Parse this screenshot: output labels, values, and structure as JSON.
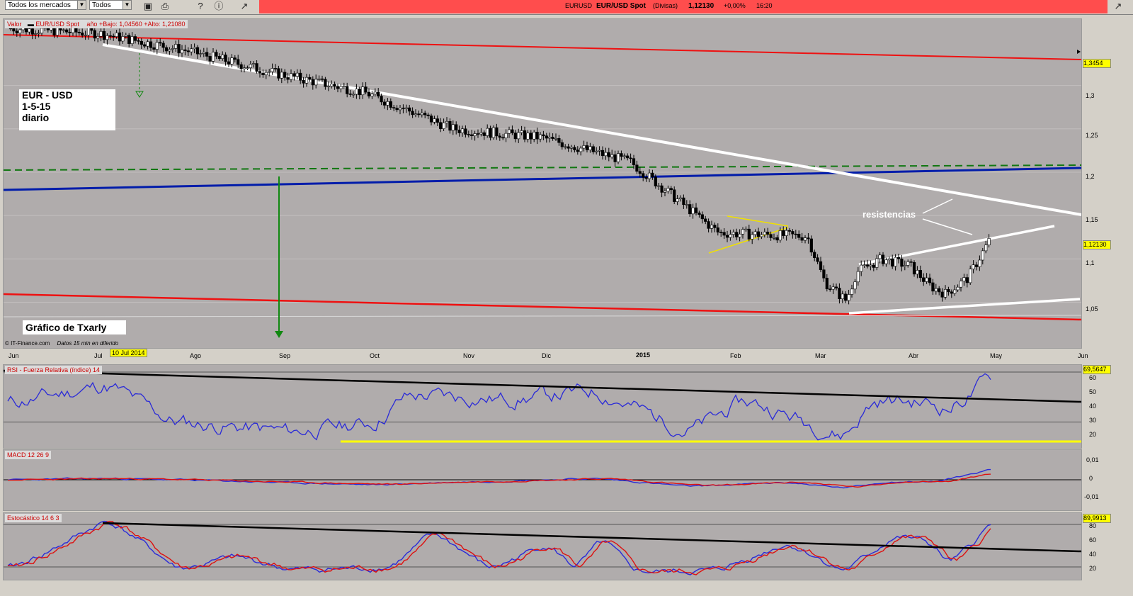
{
  "toolbar": {
    "market_select": "Todos los mercados",
    "filter_select": "Todos",
    "ticker": {
      "symbol": "EURUSD",
      "name": "EUR/USD Spot",
      "category": "(Divisas)",
      "price": "1,12130",
      "change": "+0,00%",
      "time": "16:20"
    }
  },
  "main_chart": {
    "legend_label": "Valor",
    "legend_series": "EUR/USD Spot",
    "legend_stats": "año +Bajo: 1,04560 +Alto: 1,21080",
    "y_ticks": [
      "1,3",
      "1,25",
      "1,2",
      "1,15",
      "1,1",
      "1,05"
    ],
    "badge_high": "1,3454",
    "badge_last": "1,12130",
    "note": {
      "line1": "EUR - USD",
      "line2": "1-5-15",
      "line3": "diario"
    },
    "author": "Gráfico de Txarly",
    "annotation": "resistencias",
    "credit": "© IT-Finance.com",
    "delay_note": "Datos 15 min en diferido",
    "date_marker": "10 Jul 2014",
    "x_ticks": [
      "Jun",
      "Jul",
      "Ago",
      "Sep",
      "Oct",
      "Nov",
      "Dic",
      "2015",
      "Feb",
      "Mar",
      "Abr",
      "May",
      "Jun"
    ]
  },
  "rsi_panel": {
    "label": "RSI - Fuerza Relativa (índice) 14",
    "y_ticks": [
      "60",
      "50",
      "40",
      "30",
      "20"
    ],
    "badge": "69,5647"
  },
  "macd_panel": {
    "label": "MACD 12 26 9",
    "y_ticks": [
      "0,01",
      "0",
      "-0,01"
    ]
  },
  "stoch_panel": {
    "label": "Estocástico 14 6 3",
    "y_ticks": [
      "80",
      "60",
      "40",
      "20"
    ],
    "badge": "89,9913"
  },
  "colors": {
    "ticker_bg": "#ff4d4d",
    "panel_bg": "#b0acac",
    "channel": "#ee1111",
    "trend": "#ffffff",
    "support": "#001caa",
    "green_level": "#117711",
    "rsi": "#2a2ad8",
    "signal": "#dd1111",
    "highlight": "#ffff00"
  },
  "chart_data": [
    {
      "type": "candlestick",
      "title": "EUR/USD Spot",
      "x": [
        "Jun",
        "Jul",
        "Ago",
        "Sep",
        "Oct",
        "Nov",
        "Dic",
        "2015",
        "Feb",
        "Mar",
        "Abr",
        "May",
        "Jun"
      ],
      "approx_close": [
        1.366,
        1.36,
        1.34,
        1.314,
        1.292,
        1.25,
        1.24,
        1.212,
        1.13,
        1.126,
        1.085,
        1.077,
        1.121
      ],
      "ylim": [
        1.03,
        1.37
      ],
      "year_low": 1.0456,
      "year_high": 1.2108
    },
    {
      "type": "line",
      "title": "RSI - Fuerza Relativa (índice) 14",
      "last": 69.5647,
      "ylim": [
        15,
        70
      ]
    },
    {
      "type": "line",
      "title": "MACD 12 26 9",
      "ylim": [
        -0.015,
        0.015
      ]
    },
    {
      "type": "line",
      "title": "Estocástico 14 6 3",
      "last": 89.9913,
      "ylim": [
        10,
        90
      ]
    }
  ]
}
